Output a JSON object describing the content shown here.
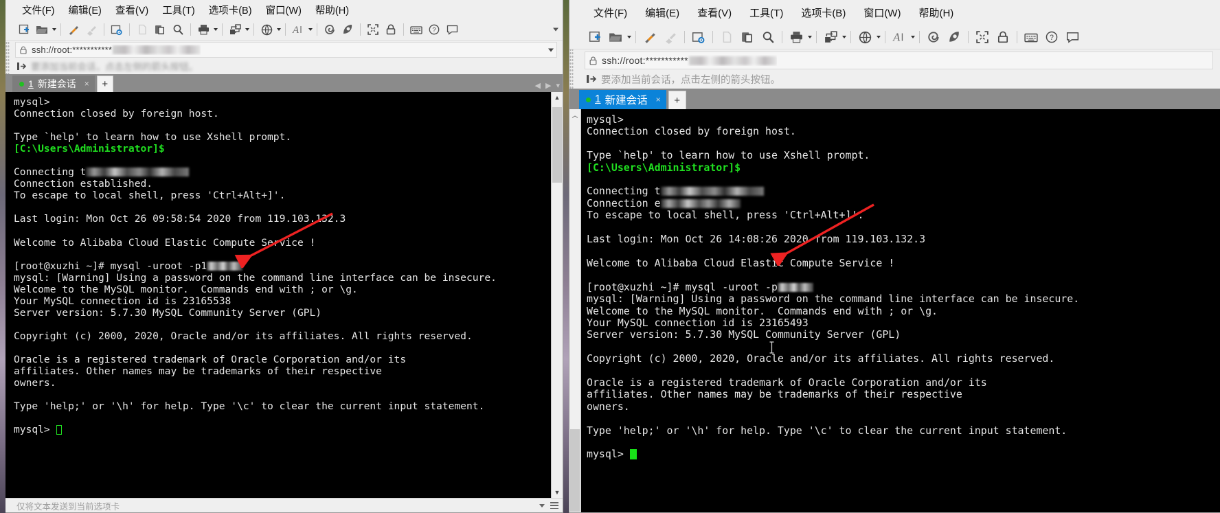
{
  "app": {
    "name": "Xshell"
  },
  "menu": {
    "items": [
      "文件(F)",
      "编辑(E)",
      "查看(V)",
      "工具(T)",
      "选项卡(B)",
      "窗口(W)",
      "帮助(H)"
    ]
  },
  "toolbar": {
    "icons": [
      {
        "name": "new-session-icon",
        "label": "新建会话"
      },
      {
        "name": "open-session-icon",
        "label": "打开"
      },
      {
        "name": "connect-icon",
        "label": "连接"
      },
      {
        "name": "disconnect-icon",
        "label": "断开"
      },
      {
        "name": "session-properties-icon",
        "label": "属性"
      },
      {
        "name": "cut-icon",
        "label": "剪切"
      },
      {
        "name": "paste-icon",
        "label": "粘贴"
      },
      {
        "name": "find-icon",
        "label": "查找"
      },
      {
        "name": "print-icon",
        "label": "打印"
      },
      {
        "name": "transfer-file-icon",
        "label": "传输文件"
      },
      {
        "name": "global-options-icon",
        "label": "全局选项"
      },
      {
        "name": "font-icon",
        "label": "字体"
      },
      {
        "name": "log-icon",
        "label": "日志"
      },
      {
        "name": "highlight-icon",
        "label": "高亮"
      },
      {
        "name": "fullscreen-icon",
        "label": "全屏"
      },
      {
        "name": "lock-icon",
        "label": "锁定"
      },
      {
        "name": "keyboard-icon",
        "label": "键盘"
      },
      {
        "name": "help-icon",
        "label": "帮助"
      },
      {
        "name": "feedback-icon",
        "label": "反馈"
      }
    ]
  },
  "address": {
    "prefix": "ssh://root:",
    "masked": "***********"
  },
  "hint": {
    "text": "要添加当前会话，点击左侧的箭头按钮。"
  },
  "tab": {
    "number": "1",
    "title": "新建会话",
    "close": "×",
    "add": "+"
  },
  "statusbar": {
    "text": "仅将文本发送到当前选项卡"
  },
  "left_terminal": {
    "lines": [
      {
        "t": "mysql>"
      },
      {
        "t": "Connection closed by foreign host."
      },
      {
        "t": ""
      },
      {
        "t": "Type `help' to learn how to use Xshell prompt."
      },
      {
        "t": "[C:\\Users\\Administrator]$",
        "c": "green"
      },
      {
        "t": ""
      },
      {
        "t": "Connecting t",
        "blur": "host"
      },
      {
        "t": "Connection established."
      },
      {
        "t": "To escape to local shell, press 'Ctrl+Alt+]'."
      },
      {
        "t": ""
      },
      {
        "t": "Last login: Mon Oct 26 09:58:54 2020 from 119.103.132.3"
      },
      {
        "t": ""
      },
      {
        "t": "Welcome to Alibaba Cloud Elastic Compute Service !"
      },
      {
        "t": ""
      },
      {
        "t": "[root@xuzhi ~]# mysql -uroot -p1",
        "blur": "pw"
      },
      {
        "t": "mysql: [Warning] Using a password on the command line interface can be insecure."
      },
      {
        "t": "Welcome to the MySQL monitor.  Commands end with ; or \\g."
      },
      {
        "t": "Your MySQL connection id is 23165538"
      },
      {
        "t": "Server version: 5.7.30 MySQL Community Server (GPL)"
      },
      {
        "t": ""
      },
      {
        "t": "Copyright (c) 2000, 2020, Oracle and/or its affiliates. All rights reserved."
      },
      {
        "t": ""
      },
      {
        "t": "Oracle is a registered trademark of Oracle Corporation and/or its"
      },
      {
        "t": "affiliates. Other names may be trademarks of their respective"
      },
      {
        "t": "owners."
      },
      {
        "t": ""
      },
      {
        "t": "Type 'help;' or '\\h' for help. Type '\\c' to clear the current input statement."
      },
      {
        "t": ""
      },
      {
        "t": "mysql> ",
        "cursor": "hollow"
      }
    ]
  },
  "right_terminal": {
    "lines": [
      {
        "t": "mysql>"
      },
      {
        "t": "Connection closed by foreign host."
      },
      {
        "t": ""
      },
      {
        "t": "Type `help' to learn how to use Xshell prompt."
      },
      {
        "t": "[C:\\Users\\Administrator]$",
        "c": "green"
      },
      {
        "t": ""
      },
      {
        "t": "Connecting t",
        "blur": "host"
      },
      {
        "t": "Connection e",
        "blur": "conn"
      },
      {
        "t": "To escape to local shell, press 'Ctrl+Alt+]'."
      },
      {
        "t": ""
      },
      {
        "t": "Last login: Mon Oct 26 14:08:26 2020 from 119.103.132.3"
      },
      {
        "t": ""
      },
      {
        "t": "Welcome to Alibaba Cloud Elastic Compute Service !"
      },
      {
        "t": ""
      },
      {
        "t": "[root@xuzhi ~]# mysql -uroot -p",
        "blur": "pw"
      },
      {
        "t": "mysql: [Warning] Using a password on the command line interface can be insecure."
      },
      {
        "t": "Welcome to the MySQL monitor.  Commands end with ; or \\g."
      },
      {
        "t": "Your MySQL connection id is 23165493"
      },
      {
        "t": "Server version: 5.7.30 MySQL Community Server (GPL)"
      },
      {
        "t": ""
      },
      {
        "t": "Copyright (c) 2000, 2020, Oracle and/or its affiliates. All rights reserved."
      },
      {
        "t": ""
      },
      {
        "t": "Oracle is a registered trademark of Oracle Corporation and/or its"
      },
      {
        "t": "affiliates. Other names may be trademarks of their respective"
      },
      {
        "t": "owners."
      },
      {
        "t": ""
      },
      {
        "t": "Type 'help;' or '\\h' for help. Type '\\c' to clear the current input statement."
      },
      {
        "t": ""
      },
      {
        "t": "mysql> ",
        "cursor": "solid"
      }
    ]
  },
  "annotations": {
    "arrow_color": "#ee2222",
    "left_arrow_label": "red-arrow-pointing-to-mysql-command",
    "right_arrow_label": "red-arrow-pointing-to-mysql-command"
  },
  "colors": {
    "window_chrome": "#efefef",
    "terminal_bg": "#000000",
    "terminal_fg": "#e6e6e6",
    "prompt_green": "#20e020",
    "active_tab_blue": "#0b83d9",
    "inactive_tab_gray": "#7d7d7d"
  }
}
